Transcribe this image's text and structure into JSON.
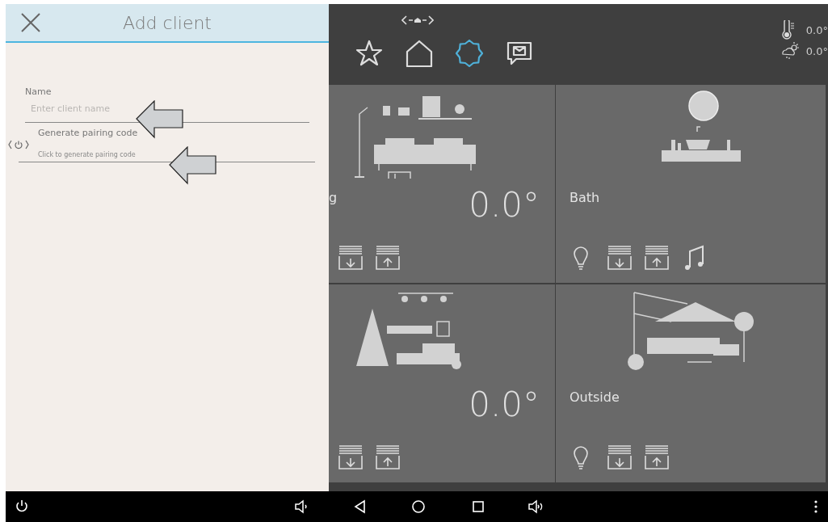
{
  "drawer": {
    "title": "Add client",
    "fields": [
      {
        "kind": "text",
        "label": "Name",
        "placeholder": "Enter client name"
      },
      {
        "kind": "action",
        "label": "Generate pairing code",
        "placeholder": "Click to generate pairing code"
      }
    ]
  },
  "top_bar": {
    "nav": [
      {
        "kind": "star",
        "selected": false
      },
      {
        "kind": "home",
        "selected": false
      },
      {
        "kind": "gear",
        "selected": true
      },
      {
        "kind": "message",
        "selected": false
      }
    ],
    "weather": [
      {
        "kind": "indoor",
        "value": "0.0°"
      },
      {
        "kind": "outdoor",
        "value": "0.0°"
      }
    ]
  },
  "tiles": [
    {
      "kind": "living",
      "name": "g",
      "temperature": "0.0°",
      "controls": [
        {
          "kind": "blind-down"
        },
        {
          "kind": "blind-up"
        }
      ]
    },
    {
      "kind": "bath",
      "name": "Bath",
      "controls": [
        {
          "kind": "light"
        },
        {
          "kind": "blind-down"
        },
        {
          "kind": "blind-up"
        },
        {
          "kind": "music"
        }
      ]
    },
    {
      "kind": "kids",
      "temperature": "0.0°",
      "controls": [
        {
          "kind": "blind-down"
        },
        {
          "kind": "blind-up"
        }
      ]
    },
    {
      "kind": "outside",
      "name": "Outside",
      "controls": [
        {
          "kind": "light"
        },
        {
          "kind": "blind-down"
        },
        {
          "kind": "blind-up"
        }
      ]
    }
  ],
  "navigation_bar": [
    {
      "kind": "power"
    },
    {
      "kind": "volume-down"
    },
    {
      "kind": "back"
    },
    {
      "kind": "home"
    },
    {
      "kind": "recents"
    },
    {
      "kind": "volume-up"
    },
    {
      "kind": "more"
    }
  ]
}
